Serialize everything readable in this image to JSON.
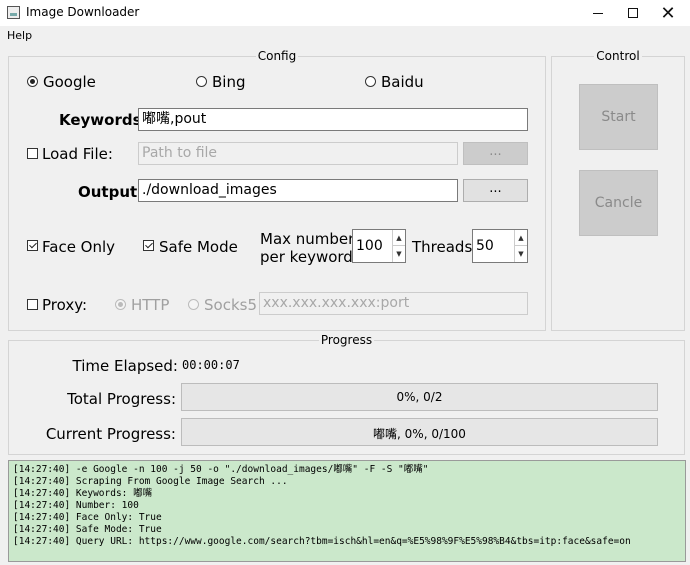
{
  "window": {
    "title": "Image Downloader",
    "minimize": "─",
    "maximize": "☐",
    "close": "✕"
  },
  "menu": {
    "help": "Help"
  },
  "config": {
    "title": "Config",
    "engines": [
      {
        "label": "Google",
        "checked": true
      },
      {
        "label": "Bing",
        "checked": false
      },
      {
        "label": "Baidu",
        "checked": false
      }
    ],
    "keywords_label": "Keywords:",
    "keywords_value": "嘟嘴,pout",
    "load_file_label": "Load File:",
    "load_file_placeholder": "Path to file",
    "load_file_browse": "...",
    "output_label": "Output:",
    "output_value": "./download_images",
    "output_browse": "...",
    "face_only_label": "Face Only",
    "safe_mode_label": "Safe Mode",
    "max_number_label_1": "Max number",
    "max_number_label_2": "per keywords",
    "max_number_value": "100",
    "threads_label": "Threads:",
    "threads_value": "50",
    "proxy_label": "Proxy:",
    "proxy_http_label": "HTTP",
    "proxy_socks5_label": "Socks5",
    "proxy_placeholder": "xxx.xxx.xxx.xxx:port"
  },
  "control": {
    "title": "Control",
    "start_label": "Start",
    "cancel_label": "Cancle"
  },
  "progress": {
    "title": "Progress",
    "time_elapsed_label": "Time Elapsed:",
    "time_elapsed_value": "00:00:07",
    "total_label": "Total Progress:",
    "total_text": "0%, 0/2",
    "total_fraction": 0,
    "current_label": "Current Progress:",
    "current_text": "嘟嘴, 0%, 0/100",
    "current_fraction": 0
  },
  "log": [
    "[14:27:40]  -e Google -n 100 -j 50 -o \"./download_images/嘟嘴\" -F -S \"嘟嘴\"",
    "[14:27:40]  Scraping From Google Image Search ...",
    "[14:27:40]  Keywords:  嘟嘴",
    "[14:27:40]  Number:  100",
    "[14:27:40]  Face Only:  True",
    "[14:27:40]  Safe Mode:  True",
    "[14:27:40]  Query URL:  https://www.google.com/search?tbm=isch&hl=en&q=%E5%98%9F%E5%98%B4&tbs=itp:face&safe=on"
  ]
}
